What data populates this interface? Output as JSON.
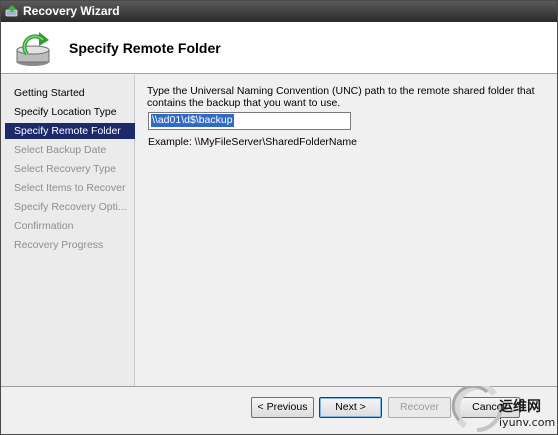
{
  "window": {
    "title": "Recovery Wizard"
  },
  "header": {
    "title": "Specify Remote Folder"
  },
  "sidebar": {
    "steps": [
      {
        "label": "Getting Started",
        "state": "done"
      },
      {
        "label": "Specify Location Type",
        "state": "done"
      },
      {
        "label": "Specify Remote Folder",
        "state": "active"
      },
      {
        "label": "Select Backup Date",
        "state": "disabled"
      },
      {
        "label": "Select Recovery Type",
        "state": "disabled"
      },
      {
        "label": "Select Items to Recover",
        "state": "disabled"
      },
      {
        "label": "Specify Recovery Opti...",
        "state": "disabled"
      },
      {
        "label": "Confirmation",
        "state": "disabled"
      },
      {
        "label": "Recovery Progress",
        "state": "disabled"
      }
    ]
  },
  "main": {
    "instruction": "Type the Universal Naming Convention (UNC) path to the remote shared folder that contains the backup that you want to use.",
    "path_value": "\\\\ad01\\d$\\backup",
    "example": "Example: \\\\MyFileServer\\SharedFolderName"
  },
  "footer": {
    "previous_label": "< Previous",
    "next_label": "Next >",
    "recover_label": "Recover",
    "cancel_label": "Cancel"
  },
  "watermark": {
    "cn_text": "运维网",
    "url": "iyunv.com"
  },
  "colors": {
    "titlebar": "#2b2b2b",
    "selection": "#1c2a6b",
    "input_highlight": "#316ac5"
  }
}
